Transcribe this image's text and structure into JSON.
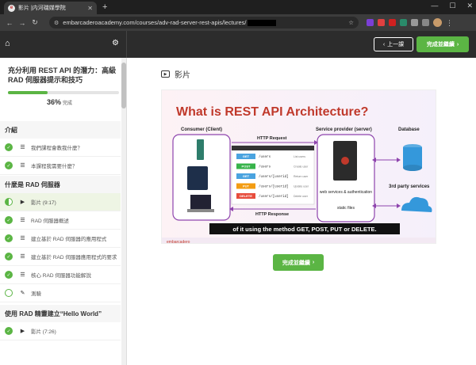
{
  "browser": {
    "tab_title": "影片 |内河磯媒學院",
    "favicon_letter": "e",
    "url": "embarcaderoacademy.com/courses/adv-rad-server-rest-apis/lectures/"
  },
  "header": {
    "prev_label": "上一課",
    "complete_label": "完成並繼續"
  },
  "sidebar": {
    "course_title": "充分利用 REST API 的潛力：高級 RAD 伺服器提示和技巧",
    "progress": 36,
    "progress_text": "36%",
    "progress_suffix": "完成",
    "sections": [
      {
        "title": "介紹",
        "lectures": [
          {
            "label": "我們課程會教我什麼？",
            "status": "done",
            "type": "text"
          },
          {
            "label": "本課程我需要什麼？",
            "status": "done",
            "type": "text"
          }
        ]
      },
      {
        "title": "什麼是 RAD 伺服器",
        "lectures": [
          {
            "label": "影片 (9:17)",
            "status": "half",
            "type": "video",
            "active": true
          },
          {
            "label": "RAD 伺服器概述",
            "status": "done",
            "type": "text"
          },
          {
            "label": "建立基於 RAD 伺服器的應用程式",
            "status": "done",
            "type": "text"
          },
          {
            "label": "建立基於 RAD 伺服器應用程式的要求",
            "status": "done",
            "type": "text"
          },
          {
            "label": "核心 RAD 伺服器功能解說",
            "status": "done",
            "type": "text"
          },
          {
            "label": "測驗",
            "status": "empty",
            "type": "quiz"
          }
        ]
      },
      {
        "title": "使用 RAD 精靈建立“Hello World”",
        "lectures": [
          {
            "label": "影片 (7:26)",
            "status": "done",
            "type": "video"
          }
        ]
      }
    ]
  },
  "main": {
    "heading": "影片",
    "continue_label": "完成並繼續"
  },
  "slide": {
    "title": "What is REST API Architecture?",
    "consumer_label": "Consumer (Client)",
    "provider_label": "Service provider (server)",
    "database_label": "Database",
    "third_party_label": "3rd party services",
    "http_request": "HTTP Request",
    "http_response": "HTTP Response",
    "server_items": [
      "web services & authentication",
      "static files"
    ],
    "requests": [
      {
        "method": "GET",
        "path": "/users",
        "desc": "List users",
        "color": "#4aa3df"
      },
      {
        "method": "POST",
        "path": "/users",
        "desc": "Create user",
        "color": "#37b34a"
      },
      {
        "method": "GET",
        "path": "/users/[userid]",
        "desc": "Return user",
        "color": "#4aa3df"
      },
      {
        "method": "PUT",
        "path": "/users/[userid]",
        "desc": "Update user",
        "color": "#f39c12"
      },
      {
        "method": "DELETE",
        "path": "/users/[userid]",
        "desc": "Delete user",
        "color": "#e74c3c"
      }
    ],
    "bottom_text": "of it using the method GET, POST, PUT or DELETE.",
    "footer_brand": "embarcadero",
    "colors": {
      "accent": "#c0392b",
      "border": "#8e44ad",
      "green": "#5bb544"
    }
  }
}
